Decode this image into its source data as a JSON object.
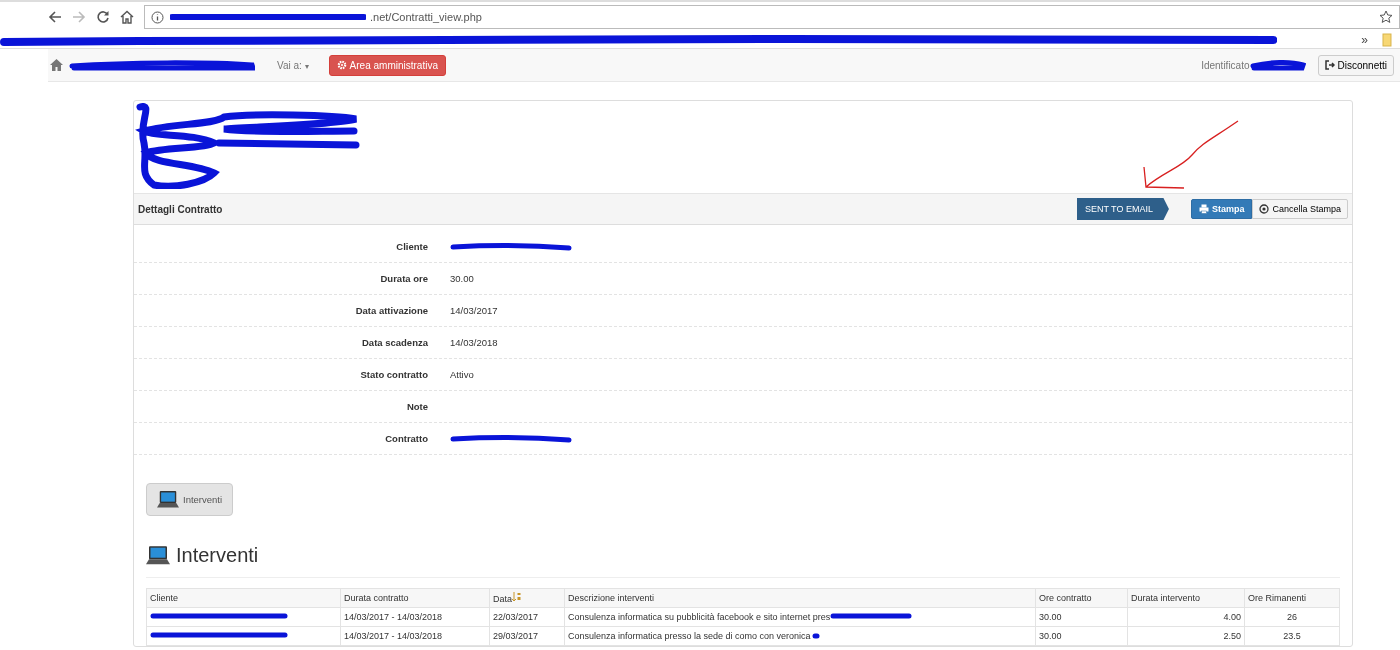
{
  "browser": {
    "url": ".net/Contratti_view.php",
    "redacted": true
  },
  "bookmarks": {
    "more": "»"
  },
  "navbar": {
    "goto": "Vai a:",
    "goto_caret": "▾",
    "admin_button": "Area amministrativa",
    "identified": "Identificato",
    "logout": "Disconnetti"
  },
  "panel": {
    "title": "Dettagli Contratto",
    "email_button": "SENT TO EMAIL",
    "print_button": "Stampa",
    "cancel_print_button": "Cancella Stampa"
  },
  "details": [
    {
      "label": "Cliente",
      "redacted": true
    },
    {
      "label": "Durata ore",
      "value": "30.00",
      "redacted": false
    },
    {
      "label": "Data attivazione",
      "value": "14/03/2017",
      "redacted": false
    },
    {
      "label": "Data scadenza",
      "value": "14/03/2018",
      "redacted": false
    },
    {
      "label": "Stato contratto",
      "value": "Attivo",
      "redacted": false
    },
    {
      "label": "Note",
      "redacted": false
    },
    {
      "label": "Contratto",
      "redacted": true
    }
  ],
  "tab_button": "Interventi",
  "section_title": "Interventi",
  "table": {
    "columns": [
      "Cliente",
      "Durata contratto",
      "Data",
      "Descrizione interventi",
      "Ore contratto",
      "Durata intervento",
      "Ore Rimanenti"
    ],
    "rows": [
      {
        "client_redacted": true,
        "period": "14/03/2017 - 14/03/2018",
        "date": "22/03/2017",
        "description": "Consulenza informatica su pubblicità facebook e sito internet pres",
        "description_redacted": true,
        "hours_contract": "30.00",
        "duration": "4.00",
        "remaining": "26"
      },
      {
        "client_redacted": true,
        "period": "14/03/2017 - 14/03/2018",
        "date": "29/03/2017",
        "description": "Consulenza informatica presso la sede di como con veronica",
        "description_redacted": true,
        "hours_contract": "30.00",
        "duration": "2.50",
        "remaining": "23.5"
      }
    ]
  }
}
